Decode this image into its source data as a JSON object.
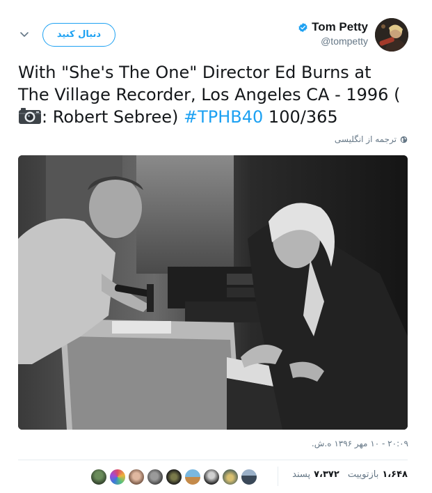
{
  "author": {
    "display_name": "Tom Petty",
    "handle": "@tompetty",
    "verified": true
  },
  "follow_label": "دنبال کنید",
  "tweet": {
    "line1": "With \"She's The One\" Director Ed Burns at",
    "line2": "The Village Recorder, Los Angeles CA - 1996 (",
    "line3_suffix": ": Robert Sebree) ",
    "hashtag": "#TPHB40",
    "count": " 100/365"
  },
  "translate_label": "ترجمه از انگلیسی",
  "timestamp": "۲۰:۰۹ - ۱۰ مهر ۱۳۹۶ ه.ش.",
  "stats": {
    "retweets_count": "۱،۶۴۸",
    "retweets_label": "بازتوییت",
    "likes_count": "۷،۳۷۲",
    "likes_label": "پسند"
  },
  "colors": {
    "accent": "#1da1f2",
    "secondary_text": "#657786"
  },
  "icons": [
    "chevron-down-icon",
    "verified-badge-icon",
    "camera-icon",
    "globe-icon"
  ]
}
